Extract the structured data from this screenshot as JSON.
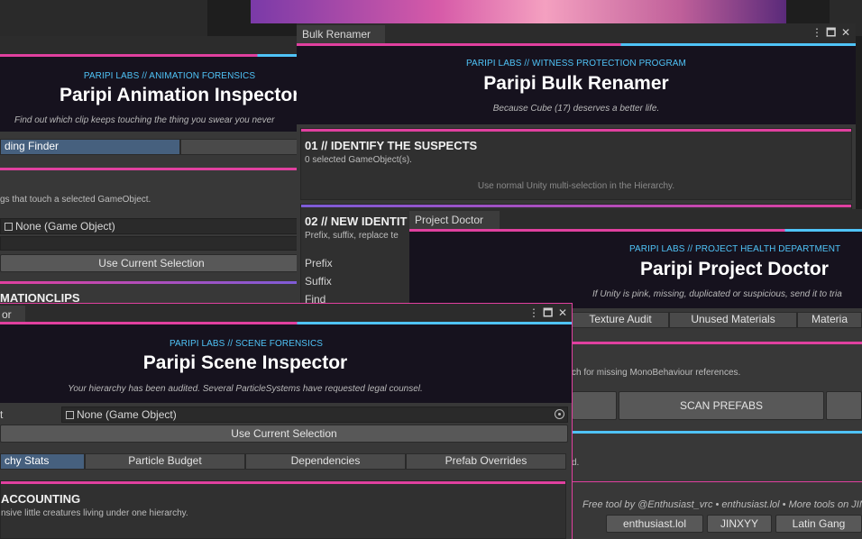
{
  "colors": {
    "pink": "#e0409f",
    "cyan": "#4fc3f7",
    "purple": "#7d5cd8",
    "header_bg": "#16121e"
  },
  "animation_inspector": {
    "kicker": "PARIPI LABS // ANIMATION FORENSICS",
    "title": "Paripi Animation Inspector",
    "tagline": "Find out which clip keeps touching the thing you swear you never",
    "active_tab": "ding Finder",
    "description": "gs that touch a selected GameObject.",
    "object_field": "None (Game Object)",
    "use_selection_label": "Use Current Selection",
    "section_partial": "MATIONCLIPS"
  },
  "bulk_renamer": {
    "tab_label": "Bulk Renamer",
    "kicker": "PARIPI LABS // WITNESS PROTECTION PROGRAM",
    "title": "Paripi Bulk Renamer",
    "tagline": "Because Cube (17) deserves a better life.",
    "section1_title": "01 // IDENTIFY THE SUSPECTS",
    "section1_count": "0 selected GameObject(s).",
    "section1_hint": "Use normal Unity multi-selection in the Hierarchy.",
    "section2_title": "02 // NEW IDENTIT",
    "section2_desc": "Prefix, suffix, replace te",
    "fields": [
      "Prefix",
      "Suffix",
      "Find"
    ]
  },
  "project_doctor": {
    "tab_label": "Project Doctor",
    "kicker": "PARIPI LABS // PROJECT HEALTH DEPARTMENT",
    "title": "Paripi Project Doctor",
    "tagline": "If Unity is pink, missing, duplicated or suspicious, send it to tria",
    "tabs": [
      "Texture Audit",
      "Unused Materials",
      "Materia"
    ],
    "description": "ch for missing MonoBehaviour references.",
    "scan_prefabs_label": "SCAN PREFABS",
    "small_text": "d.",
    "footer_credit": "Free tool by @Enthusiast_vrc • enthusiast.lol • More tools on JIN",
    "footer_buttons": [
      "enthusiast.lol",
      "JINXYY",
      "Latin Gang"
    ]
  },
  "scene_inspector": {
    "tab_label": "or",
    "kicker": "PARIPI LABS // SCENE FORENSICS",
    "title": "Paripi Scene Inspector",
    "tagline": "Your hierarchy has been audited. Several ParticleSystems have requested legal counsel.",
    "field_label": "t",
    "object_field": "None (Game Object)",
    "use_selection_label": "Use Current Selection",
    "tabs": [
      "chy Stats",
      "Particle Budget",
      "Dependencies",
      "Prefab Overrides"
    ],
    "section_title": "ACCOUNTING",
    "section_desc": "nsive little creatures living under one hierarchy."
  }
}
